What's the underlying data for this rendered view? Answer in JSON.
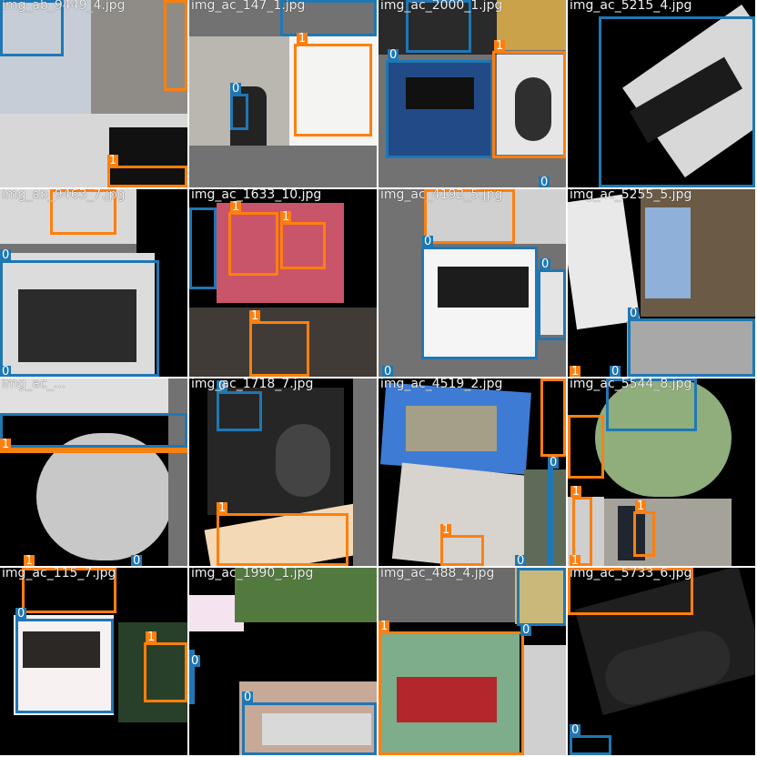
{
  "colors": {
    "class_0": "#1f77b4",
    "class_1": "#ff7f0e",
    "pad": "#727272"
  },
  "tiles": [
    {
      "filename": "img_ab_9449_4.jpg"
    },
    {
      "filename": "img_ac_147_1.jpg"
    },
    {
      "filename": "img_ac_2000_1.jpg"
    },
    {
      "filename": "img_ac_5215_4.jpg"
    },
    {
      "filename": "img_ab_9463_7.jpg"
    },
    {
      "filename": "img_ac_1633_10.jpg"
    },
    {
      "filename": "img_ac_4192_5.jpg"
    },
    {
      "filename": "img_ac_5255_5.jpg"
    },
    {
      "filename": "img_ac_..."
    },
    {
      "filename": "img_ac_1718_7.jpg"
    },
    {
      "filename": "img_ac_4519_2.jpg"
    },
    {
      "filename": "img_ac_5544_8.jpg"
    },
    {
      "filename": "img_ac_115_7.jpg"
    },
    {
      "filename": "img_ac_1990_1.jpg"
    },
    {
      "filename": "img_ac_488_4.jpg"
    },
    {
      "filename": "img_ac_5733_6.jpg"
    }
  ],
  "class_labels": {
    "c0": "0",
    "c1": "1"
  }
}
